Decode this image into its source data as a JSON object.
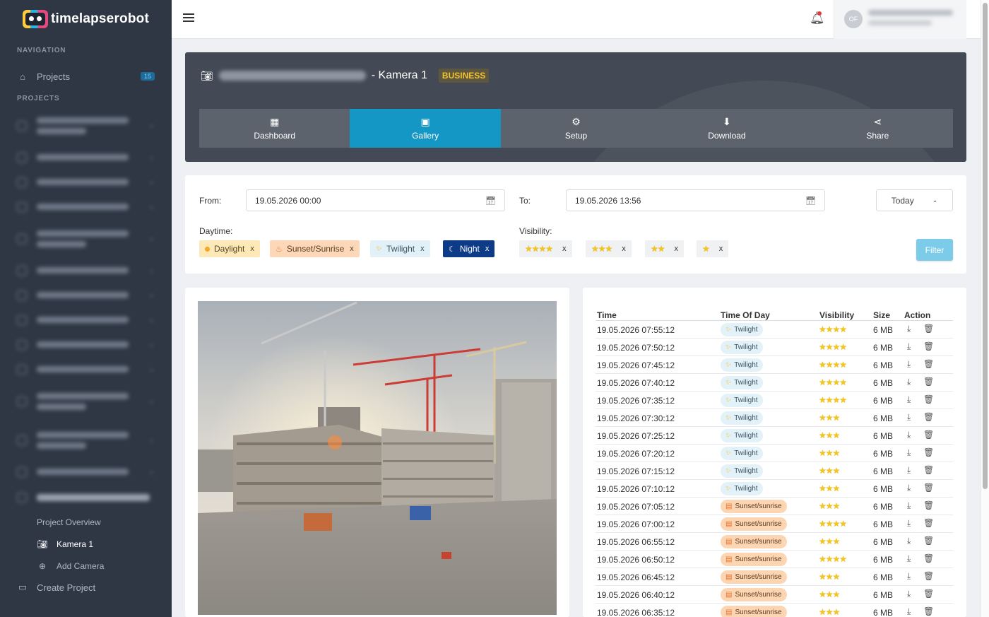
{
  "app": {
    "logo_text": "timelapserobot"
  },
  "sidebar": {
    "nav_heading": "NAVIGATION",
    "projects_item": {
      "label": "Projects",
      "badge": "15"
    },
    "projects_heading": "PROJECTS",
    "sub_items": [
      {
        "label": "Project Overview",
        "icon": "none"
      },
      {
        "label": "Kamera 1",
        "icon": "camera-icon"
      },
      {
        "label": "Add Camera",
        "icon": "add-camera-icon"
      }
    ],
    "create_project": "Create Project"
  },
  "topbar": {
    "avatar_initials": "OF"
  },
  "camera": {
    "title_suffix": "- Kamera 1",
    "plan_badge": "BUSINESS"
  },
  "tabs": [
    {
      "label": "Dashboard",
      "icon": "dashboard-icon",
      "active": false
    },
    {
      "label": "Gallery",
      "icon": "gallery-icon",
      "active": true
    },
    {
      "label": "Setup",
      "icon": "gear-icon",
      "active": false
    },
    {
      "label": "Download",
      "icon": "download-icon",
      "active": false
    },
    {
      "label": "Share",
      "icon": "share-icon",
      "active": false
    }
  ],
  "filters": {
    "from_label": "From:",
    "from_value": "19.05.2026 00:00",
    "to_label": "To:",
    "to_value": "19.05.2026 13:56",
    "range_select": "Today",
    "daytime_label": "Daytime:",
    "daytime_chips": [
      "Daylight",
      "Sunset/Sunrise",
      "Twilight",
      "Night"
    ],
    "visibility_label": "Visibility:",
    "visibility_chips": [
      4,
      3,
      2,
      1
    ],
    "remove_symbol": "x",
    "filter_button": "Filter"
  },
  "table": {
    "headers": {
      "time": "Time",
      "time_of_day": "Time Of Day",
      "visibility": "Visibility",
      "size": "Size",
      "action": "Action"
    },
    "rows": [
      {
        "time": "19.05.2026 07:55:12",
        "tod": "Twilight",
        "stars": 4,
        "size": "6 MB"
      },
      {
        "time": "19.05.2026 07:50:12",
        "tod": "Twilight",
        "stars": 4,
        "size": "6 MB"
      },
      {
        "time": "19.05.2026 07:45:12",
        "tod": "Twilight",
        "stars": 4,
        "size": "6 MB"
      },
      {
        "time": "19.05.2026 07:40:12",
        "tod": "Twilight",
        "stars": 4,
        "size": "6 MB"
      },
      {
        "time": "19.05.2026 07:35:12",
        "tod": "Twilight",
        "stars": 4,
        "size": "6 MB"
      },
      {
        "time": "19.05.2026 07:30:12",
        "tod": "Twilight",
        "stars": 3,
        "size": "6 MB"
      },
      {
        "time": "19.05.2026 07:25:12",
        "tod": "Twilight",
        "stars": 3,
        "size": "6 MB"
      },
      {
        "time": "19.05.2026 07:20:12",
        "tod": "Twilight",
        "stars": 3,
        "size": "6 MB"
      },
      {
        "time": "19.05.2026 07:15:12",
        "tod": "Twilight",
        "stars": 3,
        "size": "6 MB"
      },
      {
        "time": "19.05.2026 07:10:12",
        "tod": "Twilight",
        "stars": 3,
        "size": "6 MB"
      },
      {
        "time": "19.05.2026 07:05:12",
        "tod": "Sunset/sunrise",
        "stars": 3,
        "size": "6 MB"
      },
      {
        "time": "19.05.2026 07:00:12",
        "tod": "Sunset/sunrise",
        "stars": 4,
        "size": "6 MB"
      },
      {
        "time": "19.05.2026 06:55:12",
        "tod": "Sunset/sunrise",
        "stars": 3,
        "size": "6 MB"
      },
      {
        "time": "19.05.2026 06:50:12",
        "tod": "Sunset/sunrise",
        "stars": 4,
        "size": "6 MB"
      },
      {
        "time": "19.05.2026 06:45:12",
        "tod": "Sunset/sunrise",
        "stars": 3,
        "size": "6 MB"
      },
      {
        "time": "19.05.2026 06:40:12",
        "tod": "Sunset/sunrise",
        "stars": 3,
        "size": "6 MB"
      },
      {
        "time": "19.05.2026 06:35:12",
        "tod": "Sunset/sunrise",
        "stars": 3,
        "size": "6 MB"
      }
    ]
  },
  "colors": {
    "accent": "#1597c6",
    "sidebar_bg": "#2f3744",
    "night_chip": "#0d3b87",
    "badge": "#f2c230"
  }
}
